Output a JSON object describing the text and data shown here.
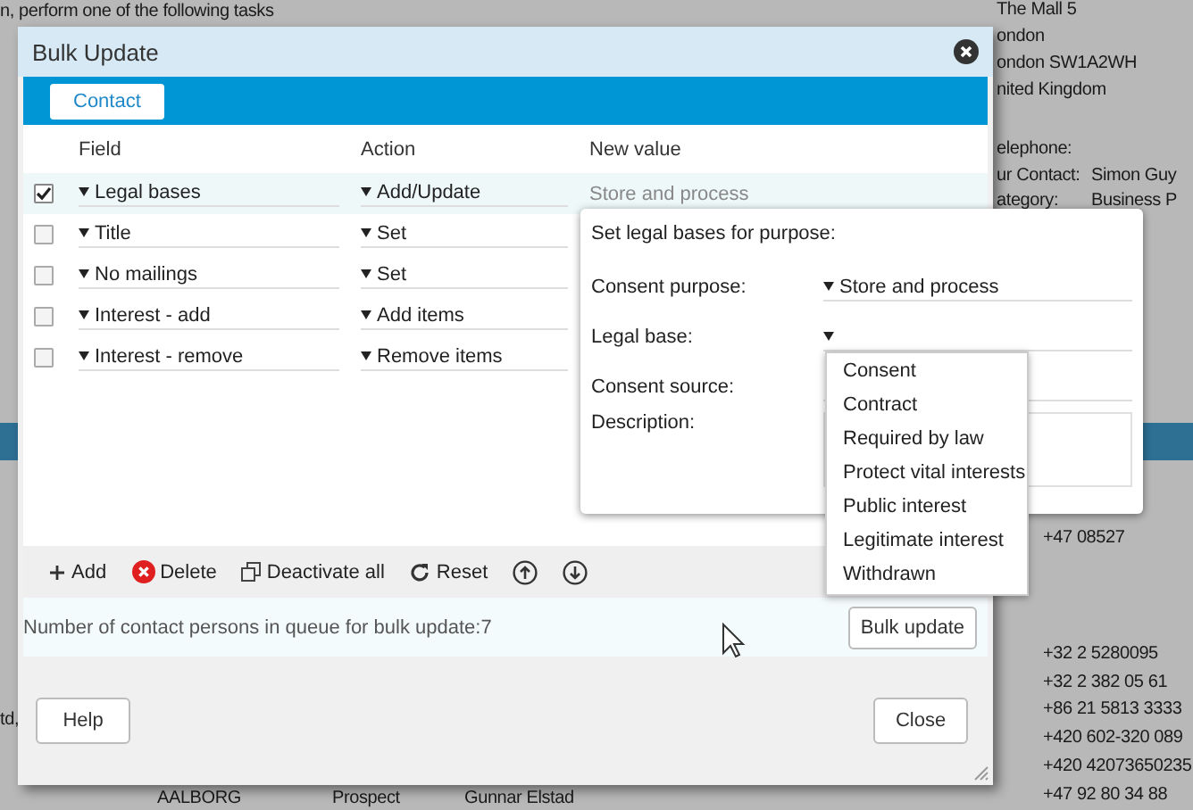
{
  "background": {
    "intro_text": "n, perform one of the following tasks",
    "address_lines": [
      "The Mall 5",
      "ondon",
      "ondon SW1A2WH",
      "nited Kingdom"
    ],
    "details": [
      {
        "label": "elephone:"
      },
      {
        "label": "ur Contact:",
        "value": "Simon Guy"
      },
      {
        "label": "ategory:",
        "value": "Business P"
      }
    ],
    "phones": [
      "+47 08527",
      "+32 2 5280095",
      "+32 2 382 05 61",
      "+86 21 5813 3333",
      "+420 602-320 089",
      "+420 42073650235",
      "+47 92 80 34 88"
    ],
    "left_fragment": "td,",
    "row": {
      "city": "AALBORG",
      "status": "Prospect",
      "contact": "Gunnar Elstad"
    }
  },
  "dialog": {
    "title": "Bulk Update",
    "tabs": [
      {
        "label": "Contact",
        "selected": true
      }
    ],
    "columns": [
      "Field",
      "Action",
      "New value"
    ],
    "rows": [
      {
        "checked": true,
        "selected": true,
        "field": "Legal bases",
        "action": "Add/Update",
        "value": "Store and process"
      },
      {
        "checked": false,
        "selected": false,
        "field": "Title",
        "action": "Set"
      },
      {
        "checked": false,
        "selected": false,
        "field": "No mailings",
        "action": "Set"
      },
      {
        "checked": false,
        "selected": false,
        "field": "Interest - add",
        "action": "Add items"
      },
      {
        "checked": false,
        "selected": false,
        "field": "Interest - remove",
        "action": "Remove items"
      }
    ],
    "popup": {
      "title": "Set legal bases for purpose:",
      "fields": [
        {
          "kind": "select",
          "label": "Consent purpose:",
          "value": "Store and process"
        },
        {
          "kind": "select",
          "label": "Legal base:"
        },
        {
          "kind": "text",
          "label": "Consent source:"
        },
        {
          "kind": "textarea",
          "label": "Description:"
        }
      ],
      "options": [
        "Consent",
        "Contract",
        "Required by law",
        "Protect vital interests",
        "Public interest",
        "Legitimate interest",
        "Withdrawn"
      ]
    },
    "toolbar": [
      {
        "kind": "add",
        "label": "Add"
      },
      {
        "kind": "delete",
        "label": "Delete"
      },
      {
        "kind": "deactivate",
        "label": "Deactivate all"
      },
      {
        "kind": "reset",
        "label": "Reset"
      },
      {
        "kind": "up"
      },
      {
        "kind": "down"
      }
    ],
    "queue_text": "Number of contact persons in queue for bulk update:7",
    "queue_button": "Bulk update",
    "buttons": [
      "Help",
      "Close"
    ]
  }
}
